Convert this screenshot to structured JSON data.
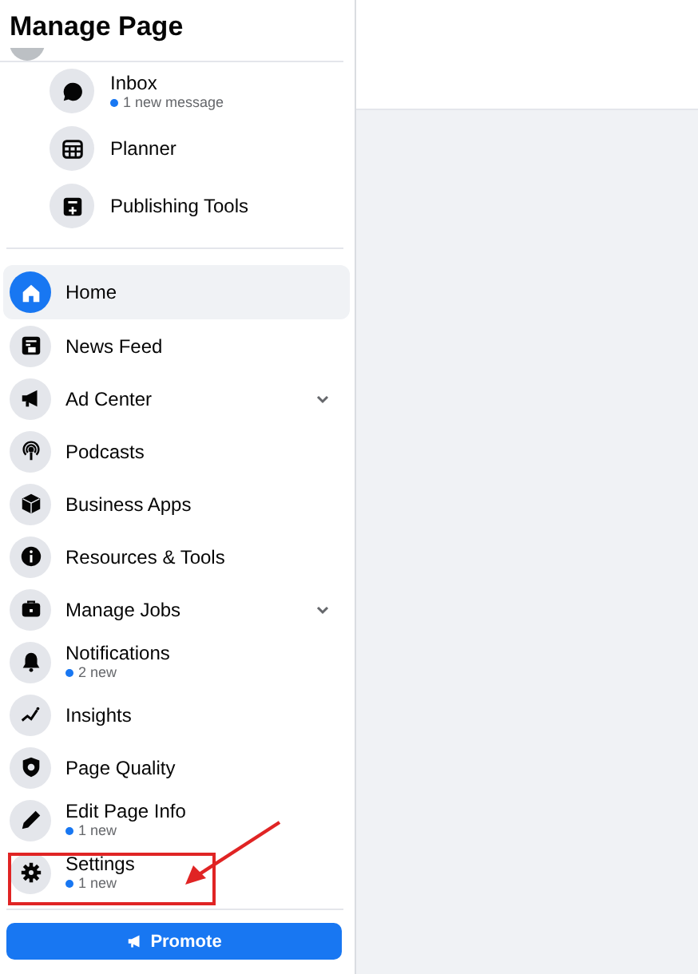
{
  "header": {
    "title": "Manage Page"
  },
  "tools": [
    {
      "label": "Inbox",
      "sub": "1 new message"
    },
    {
      "label": "Planner"
    },
    {
      "label": "Publishing Tools"
    }
  ],
  "nav": [
    {
      "label": "Home",
      "selected": true
    },
    {
      "label": "News Feed",
      "selected": false
    },
    {
      "label": "Ad Center",
      "selected": false,
      "expandable": true
    },
    {
      "label": "Podcasts",
      "selected": false
    },
    {
      "label": "Business Apps",
      "selected": false
    },
    {
      "label": "Resources & Tools",
      "selected": false
    },
    {
      "label": "Manage Jobs",
      "selected": false,
      "expandable": true
    },
    {
      "label": "Notifications",
      "selected": false,
      "sub": "2 new"
    },
    {
      "label": "Insights",
      "selected": false
    },
    {
      "label": "Page Quality",
      "selected": false
    },
    {
      "label": "Edit Page Info",
      "selected": false,
      "sub": "1 new"
    },
    {
      "label": "Settings",
      "selected": false,
      "sub": "1 new",
      "highlighted": true
    }
  ],
  "promote_button": {
    "label": "Promote"
  }
}
